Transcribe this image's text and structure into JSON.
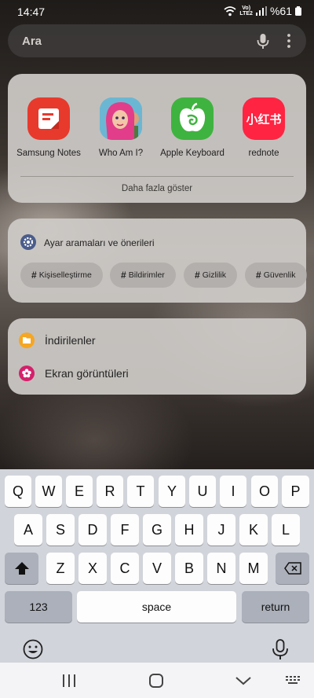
{
  "status": {
    "time": "14:47",
    "network_top": "Vo)",
    "network_bottom": "LTE2",
    "battery": "%61"
  },
  "search": {
    "placeholder": "Ara",
    "icons": [
      "microphone-icon",
      "more-vert-icon"
    ]
  },
  "apps": {
    "items": [
      {
        "label": "Samsung Notes",
        "icon": "samsung-notes-icon",
        "color": "#e8392d"
      },
      {
        "label": "Who Am I?",
        "icon": "who-am-i-icon",
        "color": "#5aa8c8"
      },
      {
        "label": "Apple Keyboard",
        "icon": "apple-keyboard-icon",
        "color": "#3fb33f"
      },
      {
        "label": "rednote",
        "icon": "rednote-icon",
        "color": "#ff2442"
      }
    ],
    "rednote_glyph": "小红书",
    "show_more": "Daha fazla göster"
  },
  "settings": {
    "title": "Ayar aramaları ve önerileri",
    "icon": "gear-icon",
    "chips": [
      "Kişiselleştirme",
      "Bildirimler",
      "Gizlilik",
      "Güvenlik"
    ],
    "chip_prefix": "#"
  },
  "folders": {
    "items": [
      {
        "label": "İndirilenler",
        "icon": "folder-icon",
        "color": "#f5a623"
      },
      {
        "label": "Ekran görüntüleri",
        "icon": "flower-icon",
        "color": "#d4206a"
      }
    ]
  },
  "keyboard": {
    "row1": [
      "Q",
      "W",
      "E",
      "R",
      "T",
      "Y",
      "U",
      "I",
      "O",
      "P"
    ],
    "row2": [
      "A",
      "S",
      "D",
      "F",
      "G",
      "H",
      "J",
      "K",
      "L"
    ],
    "row3": [
      "Z",
      "X",
      "C",
      "V",
      "B",
      "N",
      "M"
    ],
    "numbers_label": "123",
    "space_label": "space",
    "return_label": "return"
  },
  "navigation": {
    "buttons": [
      "recents-icon",
      "home-icon",
      "back-icon",
      "keyboard-toggle-icon"
    ]
  }
}
